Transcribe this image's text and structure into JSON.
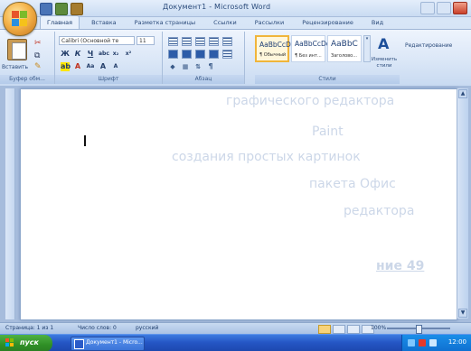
{
  "window": {
    "title": "Документ1 - Microsoft Word",
    "controls": [
      "minimize",
      "maximize",
      "close"
    ]
  },
  "quick_access": [
    {
      "name": "save-icon"
    },
    {
      "name": "undo-icon"
    },
    {
      "name": "redo-icon"
    }
  ],
  "tabs": [
    "Главная",
    "Вставка",
    "Разметка страницы",
    "Ссылки",
    "Рассылки",
    "Рецензирование",
    "Вид"
  ],
  "ribbon": {
    "clipboard": {
      "paste_label": "Вставить",
      "group_label": "Буфер обм..."
    },
    "font": {
      "font_name": "Calibri (Основной те",
      "font_size": "11",
      "group_label": "Шрифт"
    },
    "paragraph": {
      "group_label": "Абзац"
    },
    "styles": {
      "tiles": [
        {
          "big": "AaBbCcDc",
          "small": "¶ Обычный",
          "selected": true
        },
        {
          "big": "AaBbCcDc",
          "small": "¶ Без инт...",
          "selected": false
        },
        {
          "big": "AaBbC",
          "small": "Заголово...",
          "selected": false
        }
      ],
      "change_styles_label": "Изменить стили",
      "group_label": "Стили"
    },
    "editing": {
      "label": "Редактирование"
    }
  },
  "document": {
    "ghost_lines": [
      "графического редактора",
      "Paint",
      "создания простых картинок",
      "пакета Офис",
      "редактора"
    ],
    "ghost_heading": "ние 49"
  },
  "statusbar": {
    "page": "Страница: 1 из 1",
    "words": "Число слов: 0",
    "lang": "русский",
    "zoom": "100%"
  },
  "taskbar": {
    "start_label": "пуск",
    "task_label": "Документ1 - Micro...",
    "clock": "12:00"
  },
  "colors": {
    "ribbon_blue": "#dbe7f7",
    "taskbar_blue": "#2556c5",
    "start_green": "#2f8f26",
    "style_selected": "#f0b53b"
  }
}
